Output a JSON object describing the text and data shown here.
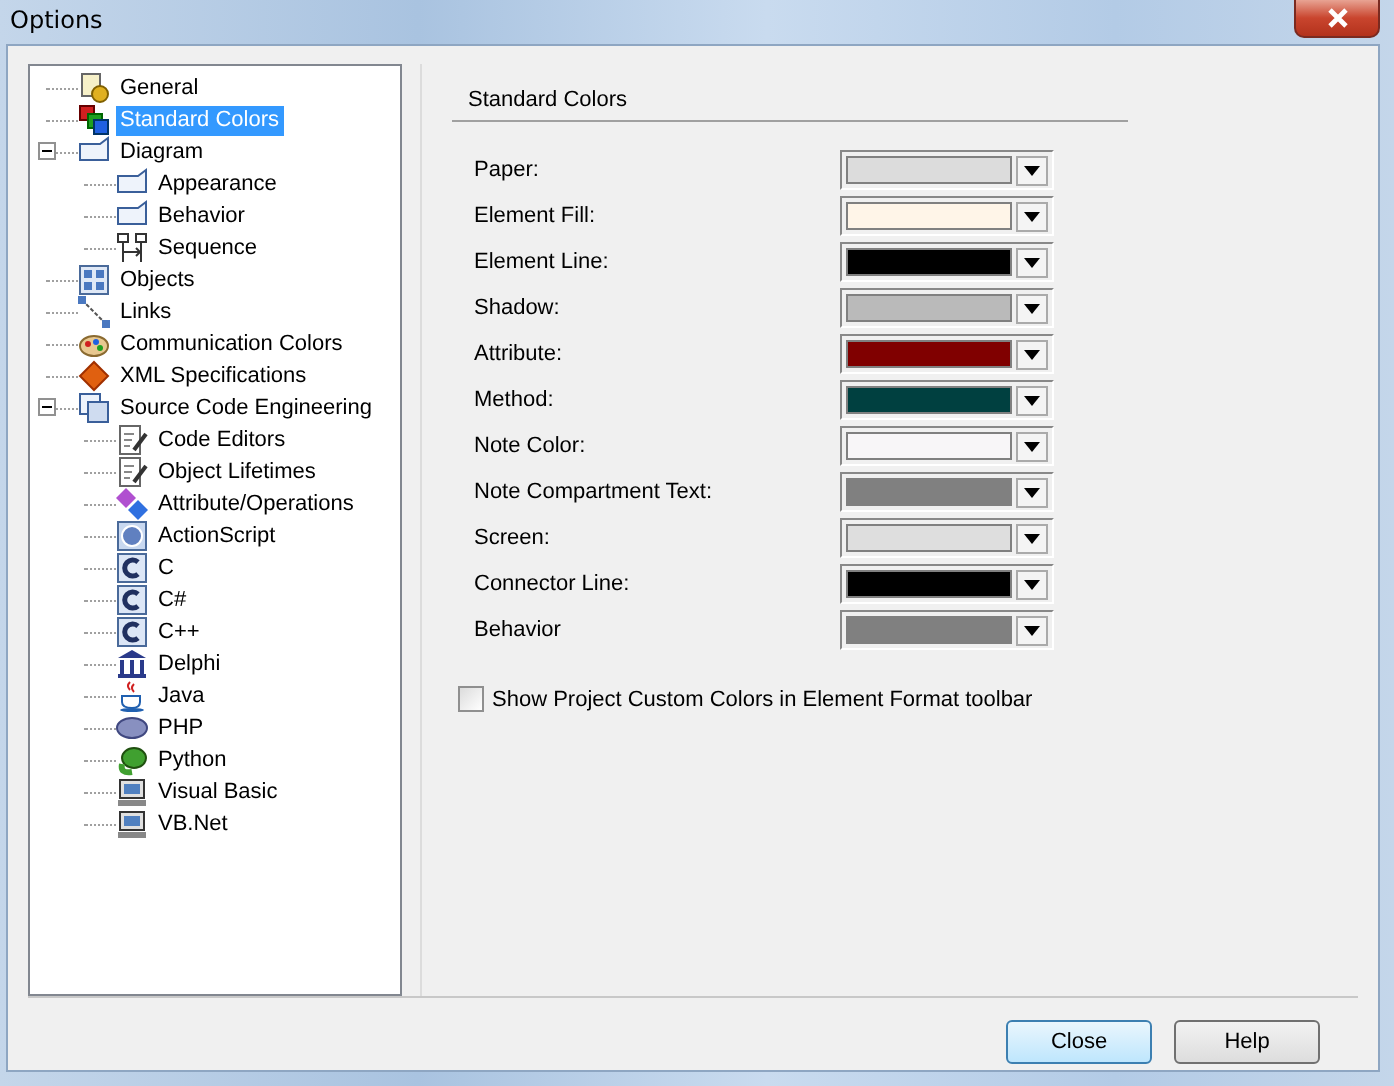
{
  "window": {
    "title": "Options"
  },
  "tree": [
    {
      "label": "General",
      "selected": false
    },
    {
      "label": "Standard Colors",
      "selected": true
    },
    {
      "label": "Diagram",
      "selected": false,
      "expanded": true,
      "children": [
        {
          "label": "Appearance",
          "selected": false
        },
        {
          "label": "Behavior",
          "selected": false
        },
        {
          "label": "Sequence",
          "selected": false
        }
      ]
    },
    {
      "label": "Objects",
      "selected": false
    },
    {
      "label": "Links",
      "selected": false
    },
    {
      "label": "Communication Colors",
      "selected": false
    },
    {
      "label": "XML Specifications",
      "selected": false
    },
    {
      "label": "Source Code Engineering",
      "selected": false,
      "expanded": true,
      "children": [
        {
          "label": "Code Editors",
          "selected": false
        },
        {
          "label": "Object Lifetimes",
          "selected": false
        },
        {
          "label": "Attribute/Operations",
          "selected": false
        },
        {
          "label": "ActionScript",
          "selected": false
        },
        {
          "label": "C",
          "selected": false
        },
        {
          "label": "C#",
          "selected": false
        },
        {
          "label": "C++",
          "selected": false
        },
        {
          "label": "Delphi",
          "selected": false
        },
        {
          "label": "Java",
          "selected": false
        },
        {
          "label": "PHP",
          "selected": false
        },
        {
          "label": "Python",
          "selected": false
        },
        {
          "label": "Visual Basic",
          "selected": false
        },
        {
          "label": "VB.Net",
          "selected": false
        }
      ]
    }
  ],
  "section_title": "Standard Colors",
  "colors": [
    {
      "label": "Paper:",
      "color": "#dcdcdc"
    },
    {
      "label": "Element Fill:",
      "color": "#fff5e8"
    },
    {
      "label": "Element Line:",
      "color": "#000000"
    },
    {
      "label": "Shadow:",
      "color": "#bababa"
    },
    {
      "label": "Attribute:",
      "color": "#800000"
    },
    {
      "label": "Method:",
      "color": "#004040"
    },
    {
      "label": "Note Color:",
      "color": "#f8f6f8"
    },
    {
      "label": "Note Compartment Text:",
      "color": "#808080"
    },
    {
      "label": "Screen:",
      "color": "#dedede"
    },
    {
      "label": "Connector Line:",
      "color": "#000000"
    },
    {
      "label": "Behavior",
      "color": "#808080"
    }
  ],
  "custom_colors_option": {
    "label": "Show Project Custom Colors in Element Format toolbar",
    "checked": false
  },
  "buttons": [
    {
      "label": "Close",
      "default": true
    },
    {
      "label": "Help",
      "default": false
    }
  ]
}
